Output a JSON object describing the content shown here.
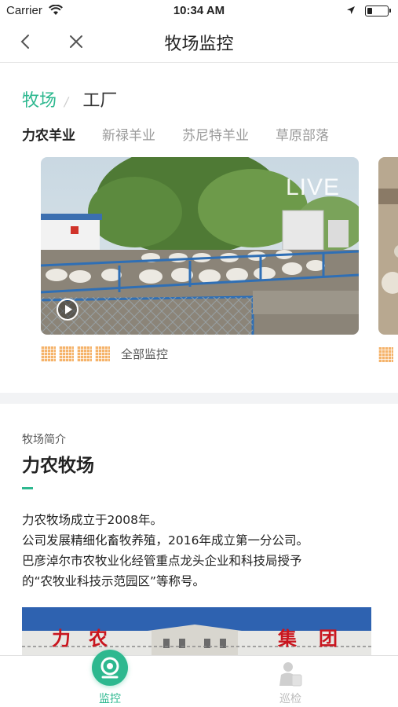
{
  "status_bar": {
    "carrier": "Carrier",
    "time": "10:34 AM",
    "battery_level": 0.25
  },
  "nav": {
    "title": "牧场监控",
    "back_icon": "chevron-left-icon",
    "close_icon": "close-icon"
  },
  "type_tabs": [
    {
      "label": "牧场",
      "active": true
    },
    {
      "label": "工厂",
      "active": false
    }
  ],
  "farm_tabs": [
    {
      "label": "力农羊业",
      "active": true
    },
    {
      "label": "新禄羊业",
      "active": false
    },
    {
      "label": "苏尼特羊业",
      "active": false
    },
    {
      "label": "草原部落",
      "active": false
    }
  ],
  "video": {
    "live_text": "LIVE"
  },
  "monitor": {
    "all_label": "全部监控"
  },
  "intro": {
    "kicker": "牧场简介",
    "title": "力农牧场",
    "lines": [
      "力农牧场成立于2008年。",
      "公司发展精细化畜牧养殖，2016年成立第一分公司。",
      "巴彦淖尔市农牧业化经管重点龙头企业和科技局授予",
      "的“农牧业科技示范园区”等称号。"
    ],
    "photo_chars": [
      "力",
      "农",
      "集",
      "团"
    ]
  },
  "tabbar": [
    {
      "label": "监控",
      "icon": "camera-icon",
      "active": true
    },
    {
      "label": "巡检",
      "icon": "inspector-icon",
      "active": false
    }
  ],
  "colors": {
    "accent": "#2db88f",
    "grid_icon": "#f5b36a",
    "divider": "#f2f3f5"
  }
}
